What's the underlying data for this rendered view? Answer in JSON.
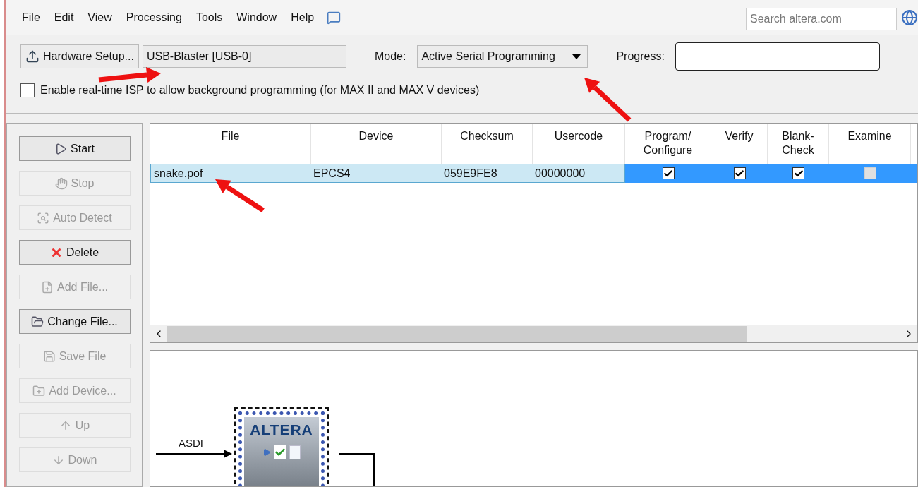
{
  "menu": [
    "File",
    "Edit",
    "View",
    "Processing",
    "Tools",
    "Window",
    "Help"
  ],
  "search": {
    "placeholder": "Search altera.com"
  },
  "toolbar": {
    "hardware_button": "Hardware Setup...",
    "hardware_value": "USB-Blaster [USB-0]",
    "mode_label": "Mode:",
    "mode_value": "Active Serial Programming",
    "progress_label": "Progress:",
    "progress": {
      "level": 0
    }
  },
  "realtime_isp": {
    "label": "Enable real-time ISP to allow background programming (for MAX II and MAX V devices)",
    "checked": false
  },
  "side_buttons": [
    {
      "label": "Start",
      "disabled": false,
      "kind": "start"
    },
    {
      "label": "Stop",
      "disabled": true,
      "kind": "stop"
    },
    {
      "label": "Auto Detect",
      "disabled": true,
      "kind": "detect"
    },
    {
      "label": "Delete",
      "disabled": false,
      "kind": "delete"
    },
    {
      "label": "Add File...",
      "disabled": true,
      "kind": "addfile"
    },
    {
      "label": "Change File...",
      "disabled": false,
      "kind": "changefile"
    },
    {
      "label": "Save File",
      "disabled": true,
      "kind": "save"
    },
    {
      "label": "Add Device...",
      "disabled": true,
      "kind": "adddevice"
    },
    {
      "label": "Up",
      "disabled": true,
      "kind": "up"
    },
    {
      "label": "Down",
      "disabled": true,
      "kind": "down"
    }
  ],
  "table": {
    "columns": [
      "File",
      "Device",
      "Checksum",
      "Usercode",
      "Program/ Configure",
      "Verify",
      "Blank- Check",
      "Examine"
    ],
    "rows": [
      {
        "selected": true,
        "file": "snake.pof",
        "device": "EPCS4",
        "checksum": "059E9FE8",
        "usercode": "00000000",
        "checks": [
          {
            "checked": true,
            "disabled": false
          },
          {
            "checked": true,
            "disabled": false
          },
          {
            "checked": true,
            "disabled": false
          },
          {
            "checked": false,
            "disabled": true
          }
        ]
      }
    ]
  },
  "diagram": {
    "signal": "ASDI",
    "chip_logo": "ALTERA"
  }
}
